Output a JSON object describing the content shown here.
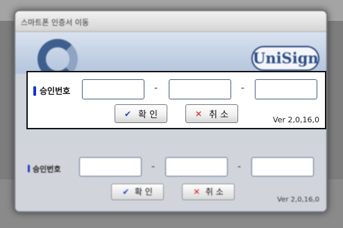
{
  "window": {
    "title": "스마트폰 인증서 이동",
    "logo_text": "UniSign"
  },
  "form": {
    "label": "승인번호",
    "fields": [
      {
        "value": "",
        "placeholder": ""
      },
      {
        "value": "",
        "placeholder": ""
      },
      {
        "value": "",
        "placeholder": ""
      }
    ],
    "separator": "-"
  },
  "buttons": {
    "ok_label": "확 인",
    "ok_icon": "checkmark-icon",
    "cancel_label": "취 소",
    "cancel_icon": "x-mark-icon"
  },
  "version": "Ver 2,0,16,0",
  "colors": {
    "accent_bar": "#1534d6",
    "ok_icon": "#2147c8",
    "cancel_icon": "#d91c1c"
  }
}
